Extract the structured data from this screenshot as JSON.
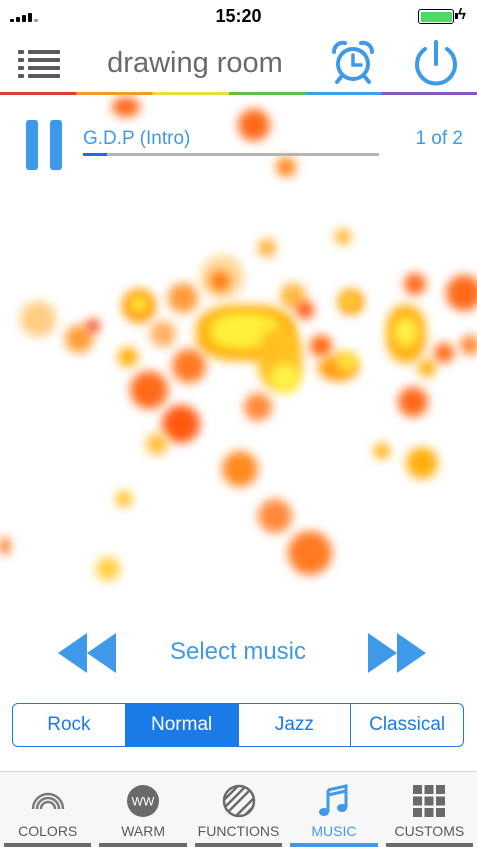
{
  "status_bar": {
    "time": "15:20"
  },
  "nav": {
    "title": "drawing room"
  },
  "player": {
    "track_title": "G.D.P (Intro)",
    "track_count": "1 of 2",
    "progress": 0.08
  },
  "controls": {
    "select_label": "Select music"
  },
  "genres": [
    {
      "label": "Rock",
      "active": false
    },
    {
      "label": "Normal",
      "active": true
    },
    {
      "label": "Jazz",
      "active": false
    },
    {
      "label": "Classical",
      "active": false
    }
  ],
  "tabs": [
    {
      "label": "COLORS",
      "active": false
    },
    {
      "label": "WARM",
      "active": false,
      "icon_text": "WW"
    },
    {
      "label": "FUNCTIONS",
      "active": false
    },
    {
      "label": "MUSIC",
      "active": true
    },
    {
      "label": "CUSTOMS",
      "active": false
    }
  ],
  "colors": {
    "accent": "#3e9ae8",
    "segment_active": "#1a7be8",
    "battery": "#4cd964"
  }
}
